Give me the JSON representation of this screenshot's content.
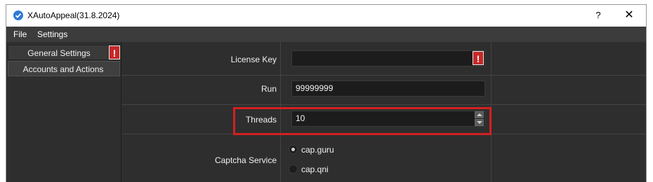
{
  "window": {
    "title": "XAutoAppeal(31.8.2024)",
    "help_label": "?",
    "close_label": "✕"
  },
  "menubar": {
    "items": [
      "File",
      "Settings"
    ]
  },
  "sidebar": {
    "items": [
      {
        "label": "General Settings",
        "active": true,
        "warning": "!"
      },
      {
        "label": "Accounts and Actions",
        "active": false
      }
    ]
  },
  "form": {
    "license_key": {
      "label": "License Key",
      "value": "",
      "warning": "!"
    },
    "run": {
      "label": "Run",
      "value": "99999999"
    },
    "threads": {
      "label": "Threads",
      "value": "10"
    },
    "captcha_service": {
      "label": "Captcha Service",
      "options": [
        {
          "label": "cap.guru",
          "checked": true
        },
        {
          "label": "cap.qni",
          "checked": false
        }
      ]
    }
  },
  "colors": {
    "accent_warning": "#c62828",
    "highlight_box": "#d32020",
    "app_icon": "#2f7bd6"
  }
}
